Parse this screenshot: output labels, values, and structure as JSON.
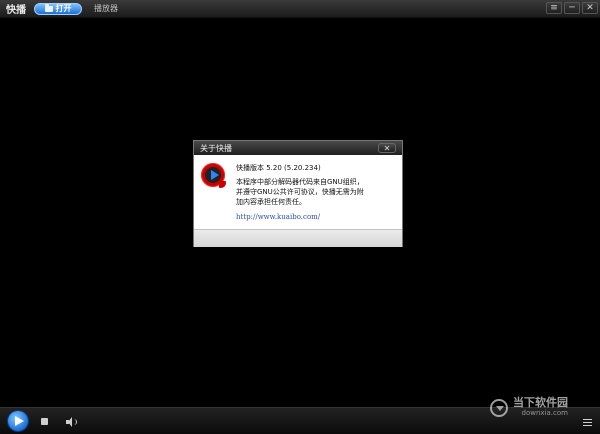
{
  "titlebar": {
    "app_title": "快播",
    "open_label": "打开",
    "menu_playlist": "播放器",
    "window_controls": [
      "≡",
      "─",
      "✕"
    ]
  },
  "dialog": {
    "title": "关于快播",
    "close_label": "✕",
    "version": "快播版本 5.20 (5.20.234)",
    "desc_lines": [
      "本程序中部分解码器代码来自GNU组织，",
      "并遵守GNU公共许可协议，快播无需为附",
      "加内容承担任何责任。"
    ],
    "link": "http://www.kuaibo.com/"
  },
  "watermark": {
    "cn": "当下软件园",
    "en": "downxia.com"
  },
  "icons": {
    "play": "play-icon",
    "stop": "stop-icon",
    "volume": "volume-icon",
    "playlist_toggle": "playlist-toggle-icon"
  },
  "colors": {
    "accent": "#1d6fd9",
    "logo_red": "#c90000",
    "link": "#2a4fb8"
  }
}
